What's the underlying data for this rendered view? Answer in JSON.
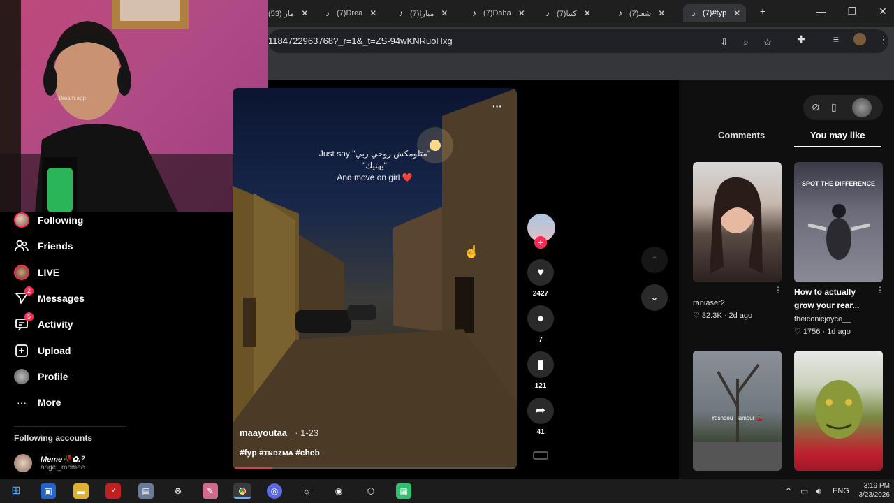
{
  "browser": {
    "tabs": [
      {
        "label": "(53) مار",
        "active": false
      },
      {
        "label": "(7)Drea",
        "active": false
      },
      {
        "label": "مبارا(7)",
        "active": false
      },
      {
        "label": "(7)Daha",
        "active": false
      },
      {
        "label": "كنيا(7)",
        "active": false
      },
      {
        "label": "شعـ(7)",
        "active": false
      },
      {
        "label": "(7)#fyp",
        "active": true
      }
    ],
    "url": "1184722963768?_r=1&_t=ZS-94wKNRuoHxg"
  },
  "sidebar": {
    "items": [
      {
        "label": "Following",
        "icon": "avatar-icon",
        "badge": ""
      },
      {
        "label": "Friends",
        "icon": "friends-icon",
        "badge": ""
      },
      {
        "label": "LIVE",
        "icon": "live-icon",
        "badge": ""
      },
      {
        "label": "Messages",
        "icon": "messages-icon",
        "badge": "2"
      },
      {
        "label": "Activity",
        "icon": "activity-icon",
        "badge": "5"
      },
      {
        "label": "Upload",
        "icon": "upload-icon",
        "badge": ""
      },
      {
        "label": "Profile",
        "icon": "profile-icon",
        "badge": ""
      },
      {
        "label": "More",
        "icon": "more-icon",
        "badge": ""
      }
    ],
    "following_accounts_heading": "Following accounts",
    "account": {
      "name": "Meme🥀✿.⁰",
      "handle": "angel_memee"
    }
  },
  "video": {
    "caption_line1": "Just say \"متلومكش روحي ربي\"",
    "caption_line2": "\"يهنيك\"",
    "caption_line3": "And move on girl ❤️",
    "author": "maayoutaa_",
    "date": "· 1-23",
    "tags": "#fyp #ᴛɴᴅᴢᴍᴀ #cheb",
    "progress": 0.14,
    "more_label": "···"
  },
  "actions": {
    "likes": "2427",
    "comments": "7",
    "saves": "121",
    "shares": "41"
  },
  "right_panel": {
    "tabs": [
      "Comments",
      "You may like"
    ],
    "active_tab": "You may like",
    "cards": [
      {
        "author": "raniaser2",
        "likes": "32.3K",
        "age": "2d ago",
        "title": "",
        "overlay": ""
      },
      {
        "author": "theiconicjoyce__",
        "likes": "1756",
        "age": "1d ago",
        "title": "How to actually grow your rear...",
        "overlay": "SPOT THE DIFFERENCE"
      },
      {
        "author": "",
        "likes": "",
        "age": "",
        "title": "",
        "overlay": "Yoshbou_ lamour 🍒"
      },
      {
        "author": "",
        "likes": "",
        "age": "",
        "title": "",
        "overlay": ""
      }
    ]
  },
  "webcam": {
    "watermark": "...dream.app"
  },
  "taskbar": {
    "language": "ENG",
    "time": "3:19 PM",
    "date": "3/23/2026"
  },
  "colors": {
    "accent": "#fe2c55",
    "panel": "#0f0f0f"
  }
}
